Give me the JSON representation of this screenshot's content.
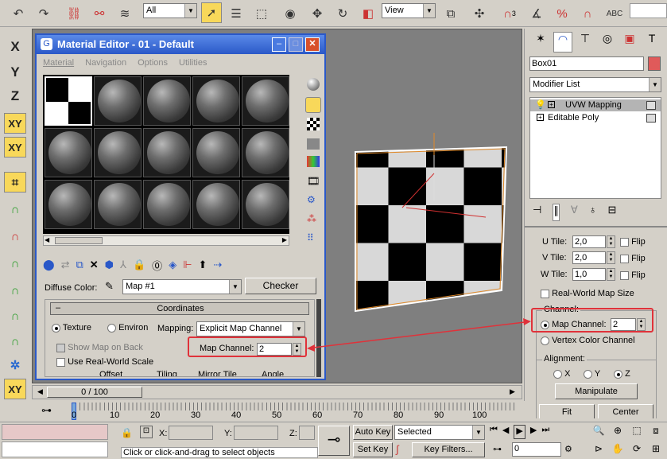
{
  "toolbar": {
    "filter_value": "All",
    "view_value": "View",
    "snap_3": "3",
    "snap_angle": "n",
    "snap_percent": "%"
  },
  "material_editor": {
    "title": "Material Editor - 01 - Default",
    "menu": [
      "Material",
      "Navigation",
      "Options",
      "Utilities"
    ],
    "diffuse_label": "Diffuse Color:",
    "map_name": "Map #1",
    "map_type": "Checker",
    "rollout_toggle": "–",
    "rollout_title": "Coordinates",
    "texture_label": "Texture",
    "environ_label": "Environ",
    "mapping_label": "Mapping:",
    "mapping_value": "Explicit Map Channel",
    "show_map_label": "Show Map on Back",
    "map_channel_label": "Map Channel:",
    "map_channel_value": "2",
    "real_world_label": "Use Real-World Scale",
    "offset_label": "Offset",
    "tiling_label": "Tiling",
    "mirror_label": "Mirror Tile",
    "angle_label": "Angle"
  },
  "left_toolbar": {
    "x": "X",
    "y": "Y",
    "z": "Z",
    "xy": "XY",
    "xy2": "XY",
    "xy3": "XY"
  },
  "command_panel": {
    "object_name": "Box01",
    "modifier_list": "Modifier List",
    "stack": [
      "UVW Mapping",
      "Editable Poly"
    ],
    "u_tile_label": "U Tile:",
    "u_tile": "2,0",
    "v_tile_label": "V Tile:",
    "v_tile": "2,0",
    "w_tile_label": "W Tile:",
    "w_tile": "1,0",
    "flip": "Flip",
    "real_world_label": "Real-World Map Size",
    "channel_group": "Channel:",
    "map_channel_label": "Map Channel:",
    "map_channel_value": "2",
    "vertex_color_label": "Vertex Color Channel",
    "alignment_group": "Alignment:",
    "axis_x": "X",
    "axis_y": "Y",
    "axis_z": "Z",
    "manipulate": "Manipulate",
    "fit": "Fit",
    "center": "Center"
  },
  "timeline": {
    "frame_display": "0 / 100",
    "ticks": [
      "0",
      "10",
      "20",
      "30",
      "40",
      "50",
      "60",
      "70",
      "80",
      "90",
      "100"
    ]
  },
  "status": {
    "x_label": "X:",
    "y_label": "Y:",
    "z_label": "Z:",
    "auto_key": "Auto Key",
    "selected": "Selected",
    "set_key": "Set Key",
    "key_filters": "Key Filters...",
    "frame_value": "0",
    "prompt": "Click or click-and-drag to select objects"
  },
  "colors": {
    "title_blue": "#2a58c8",
    "highlight": "#e0323a",
    "viewport": "#7f7f7f"
  }
}
